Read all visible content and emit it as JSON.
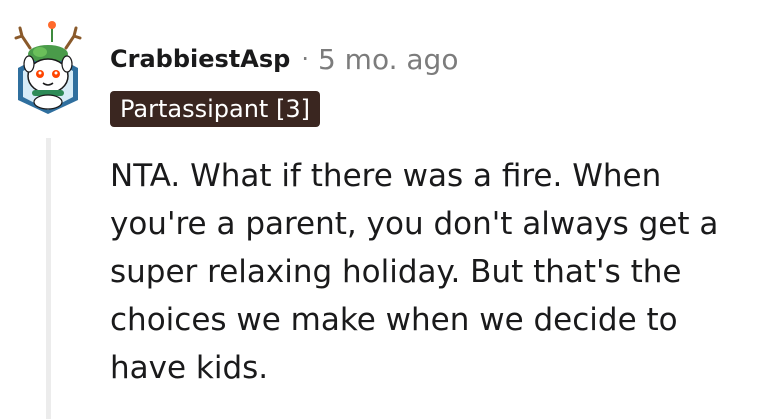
{
  "comment": {
    "username": "CrabbiestAsp",
    "separator": "·",
    "time_ago": "5 mo. ago",
    "flair": "Partassipant [3]",
    "body": "NTA. What if there was a fire. When you're a parent, you don't always get a super relaxing holiday. But that's the choices we make when we decide to have kids.",
    "avatar_icon": "snoo-reindeer-avatar-icon"
  },
  "colors": {
    "username": "#1a1a1b",
    "meta": "#7c7c7c",
    "flair_bg": "#3a2620",
    "flair_text": "#ffffff",
    "thread_line": "#ececec",
    "avatar_hex": "#2f6f9e"
  }
}
